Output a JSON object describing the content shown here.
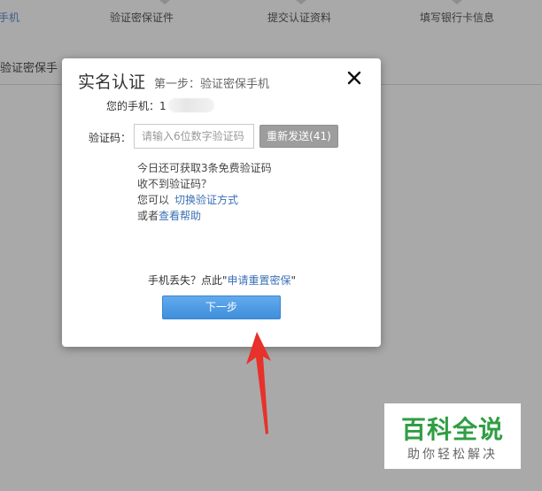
{
  "background": {
    "steps": [
      {
        "label": "手机"
      },
      {
        "label": "验证密保证件"
      },
      {
        "label": "提交认证资料"
      },
      {
        "label": "填写银行卡信息"
      }
    ],
    "section_title": "验证密保手"
  },
  "modal": {
    "title": "实名认证",
    "subtitle": "第一步：验证密保手机",
    "close_icon": "close-icon",
    "phone_label": "您的手机：",
    "phone_value": "1",
    "code_label": "验证码：",
    "code_placeholder": "请输入6位数字验证码",
    "resend_label": "重新发送(41)",
    "tips": {
      "line1": "今日还可获取3条免费验证码",
      "line2": "收不到验证码？",
      "line3_prefix": "您可以",
      "line3_link": "切换验证方式",
      "line4_prefix": "或者",
      "line4_link": "查看帮助"
    },
    "lost": {
      "prefix": "手机丢失？点此\"",
      "link": "申请重置密保",
      "suffix": "\""
    },
    "next_label": "下一步"
  },
  "annotation": {
    "arrow_color": "#e8312a"
  },
  "watermark": {
    "main": "百科全说",
    "sub": "助你轻松解决"
  }
}
